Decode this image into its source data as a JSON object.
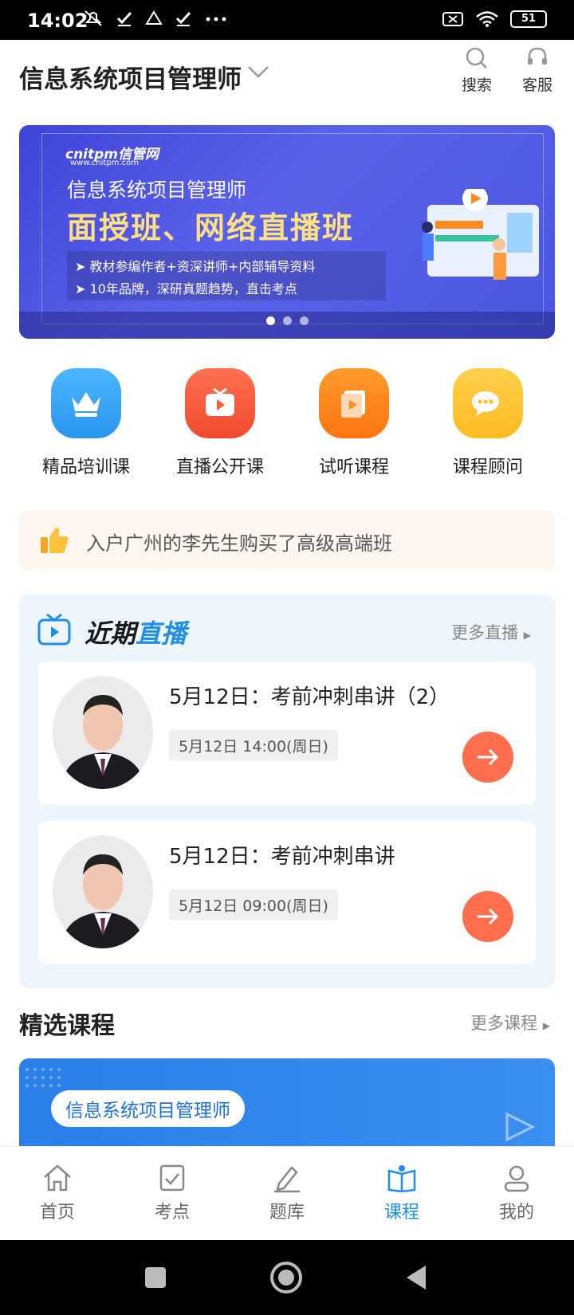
{
  "status_bar": {
    "time": "14:02",
    "battery": "51",
    "icons": [
      "mute-icon",
      "check-icon",
      "drive-icon",
      "check-icon",
      "more-icon"
    ]
  },
  "header": {
    "title": "信息系统项目管理师",
    "search_label": "搜索",
    "service_label": "客服"
  },
  "banner": {
    "logo": "cnitpm信管网",
    "logo_sub": "www.cnitpm.com",
    "line1": "信息系统项目管理师",
    "line2": "面授班、网络直播班",
    "bullet1": "教材参编作者+资深讲师+内部辅导资料",
    "bullet2": "10年品牌，深研真题趋势，直击考点",
    "page_count": 3,
    "active_index": 0
  },
  "quick_entries": [
    {
      "label": "精品培训课",
      "icon": "crown-icon",
      "color": "#3aa8f5"
    },
    {
      "label": "直播公开课",
      "icon": "tv-play-icon",
      "color": "#f7603d"
    },
    {
      "label": "试听课程",
      "icon": "book-play-icon",
      "color": "#ff8a1e"
    },
    {
      "label": "课程顾问",
      "icon": "chat-icon",
      "color": "#ffc93a"
    }
  ],
  "notice": {
    "icon": "thumbs-up-icon",
    "text": "入户广州的李先生购买了高级高端班"
  },
  "live": {
    "title_a": "近期",
    "title_b": "直播",
    "more": "更多直播",
    "items": [
      {
        "title": "5月12日：考前冲刺串讲（2）",
        "time": "5月12日 14:00(周日)"
      },
      {
        "title": "5月12日：考前冲刺串讲",
        "time": "5月12日 09:00(周日)"
      }
    ]
  },
  "selected": {
    "title": "精选课程",
    "more": "更多课程",
    "course_tag": "信息系统项目管理师"
  },
  "bottom_nav": [
    {
      "label": "首页",
      "icon": "home-icon"
    },
    {
      "label": "考点",
      "icon": "checklist-icon"
    },
    {
      "label": "题库",
      "icon": "edit-icon"
    },
    {
      "label": "课程",
      "icon": "course-book-icon",
      "active": true
    },
    {
      "label": "我的",
      "icon": "user-icon"
    }
  ],
  "colors": {
    "accent": "#1e8ee8",
    "go_button": "#ff6f4e",
    "banner": "#4a56e0"
  }
}
